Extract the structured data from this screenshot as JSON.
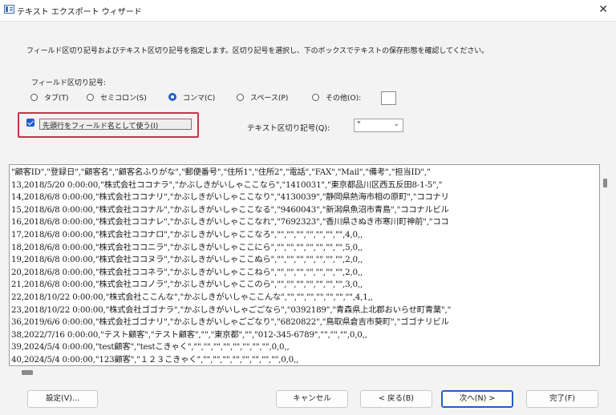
{
  "window": {
    "title": "テキスト エクスポート ウィザード"
  },
  "instruction": "フィールド区切り記号およびテキスト区切り記号を指定します。区切り記号を選択し、下のボックスでテキストの保存形態を確認してください。",
  "field_delimiter": {
    "label": "フィールド区切り記号:",
    "options": [
      {
        "label": "タブ(T)",
        "selected": false
      },
      {
        "label": "セミコロン(S)",
        "selected": false
      },
      {
        "label": "コンマ(C)",
        "selected": true
      },
      {
        "label": "スペース(P)",
        "selected": false
      },
      {
        "label": "その他(O):",
        "selected": false
      }
    ],
    "other_value": ""
  },
  "first_row_checkbox": {
    "label": "先頭行をフィールド名として使う(I)",
    "checked": true
  },
  "text_qualifier": {
    "label": "テキスト区切り記号(Q):",
    "value": "\""
  },
  "preview_lines": [
    "\"顧客ID\",\"登録日\",\"顧客名\",\"顧客名ふりがな\",\"郵便番号\",\"住所1\",\"住所2\",\"電話\",\"FAX\",\"Mail\",\"備考\",\"担当ID\",\"",
    "13,2018/5/20 0:00:00,\"株式会社ココナラ\",\"かぶしきがいしゃここなら\",\"1410031\",\"東京都品川区西五反田8-1-5\",\"",
    "14,2018/6/8 0:00:00,\"株式会社ココナリ\",\"かぶしきがいしゃここなり\",\"4130039\",\"静岡県熱海市相の原町\",\"ココナリ",
    "15,2018/6/8 0:00:00,\"株式会社ココナル\",\"かぶしきがいしゃここなる\",\"9460043\",\"新潟県魚沼市青島\",\"ココナルビル",
    "16,2018/6/8 0:00:00,\"株式会社ココナレ\",\"かぶしきがいしゃここなれ\",\"7692323\",\"香川県さぬき市寒川町神前\",\"ココ",
    "17,2018/6/8 0:00:00,\"株式会社ココナロ\",\"かぶしきがいしゃここなろ\",\"\",\"\",\"\",\"\",\"\",\"\",\"\",4,0,,",
    "18,2018/6/8 0:00:00,\"株式会社ココニラ\",\"かぶしきがいしゃここにら\",\"\",\"\",\"\",\"\",\"\",\"\",\"\",5,0,,",
    "19,2018/6/8 0:00:00,\"株式会社ココヌラ\",\"かぶしきがいしゃここぬら\",\"\",\"\",\"\",\"\",\"\",\"\",\"\",2,0,,",
    "20,2018/6/8 0:00:00,\"株式会社ココネラ\",\"かぶしきがいしゃここねら\",\"\",\"\",\"\",\"\",\"\",\"\",\"\",2,0,,",
    "21,2018/6/8 0:00:00,\"株式会社ココノラ\",\"かぶしきがいしゃここのら\",\"\",\"\",\"\",\"\",\"\",\"\",\"\",3,0,,",
    "22,2018/10/22 0:00:00,\"株式会社ここんな\",\"かぶしきがいしゃここんな\",\"\",\"\",\"\",\"\",\"\",\"\",\"\",4,1,,",
    "23,2018/10/22 0:00:00,\"株式会社ゴゴナラ\",\"かぶしきがいしゃごごなら\",\"0392189\",\"青森県上北郡おいらせ町青葉\",\"",
    "36,2019/6/6 0:00:00,\"株式会社ゴゴナリ\",\"かぶしきがいしゃごごなり\",\"6820822\",\"鳥取県倉吉市葵町\",\"ゴゴナリビル",
    "38,2022/7/16 0:00:00,\"テスト顧客\",\"テスト顧客\",\"\",\"東京都\",\"\",\"012-345-6789\",\"\",\"\",\"\",0,0,,",
    "39,2024/5/4 0:00:00,\"test顧客\",\"testこきゃく\",\"\",\"\",\"\",\"\",\"\",\"\",\"\",\"\",0,0,,",
    "40,2024/5/4 0:00:00,\"123顧客\",\"１２３こきゃく\",\"\",\"\",\"\",\"\",\"\",\"\",\"\",\"\",0,0,,"
  ],
  "buttons": {
    "settings": "設定(V)...",
    "cancel": "キャンセル",
    "back": "< 戻る(B)",
    "next": "次へ(N) >",
    "finish": "完了(F)"
  },
  "colors": {
    "accent": "#1f5fc8",
    "highlight": "#c0364a"
  },
  "icons": {
    "close": "close-icon",
    "dropdown": "chevron-down-icon",
    "app": "app-icon"
  }
}
